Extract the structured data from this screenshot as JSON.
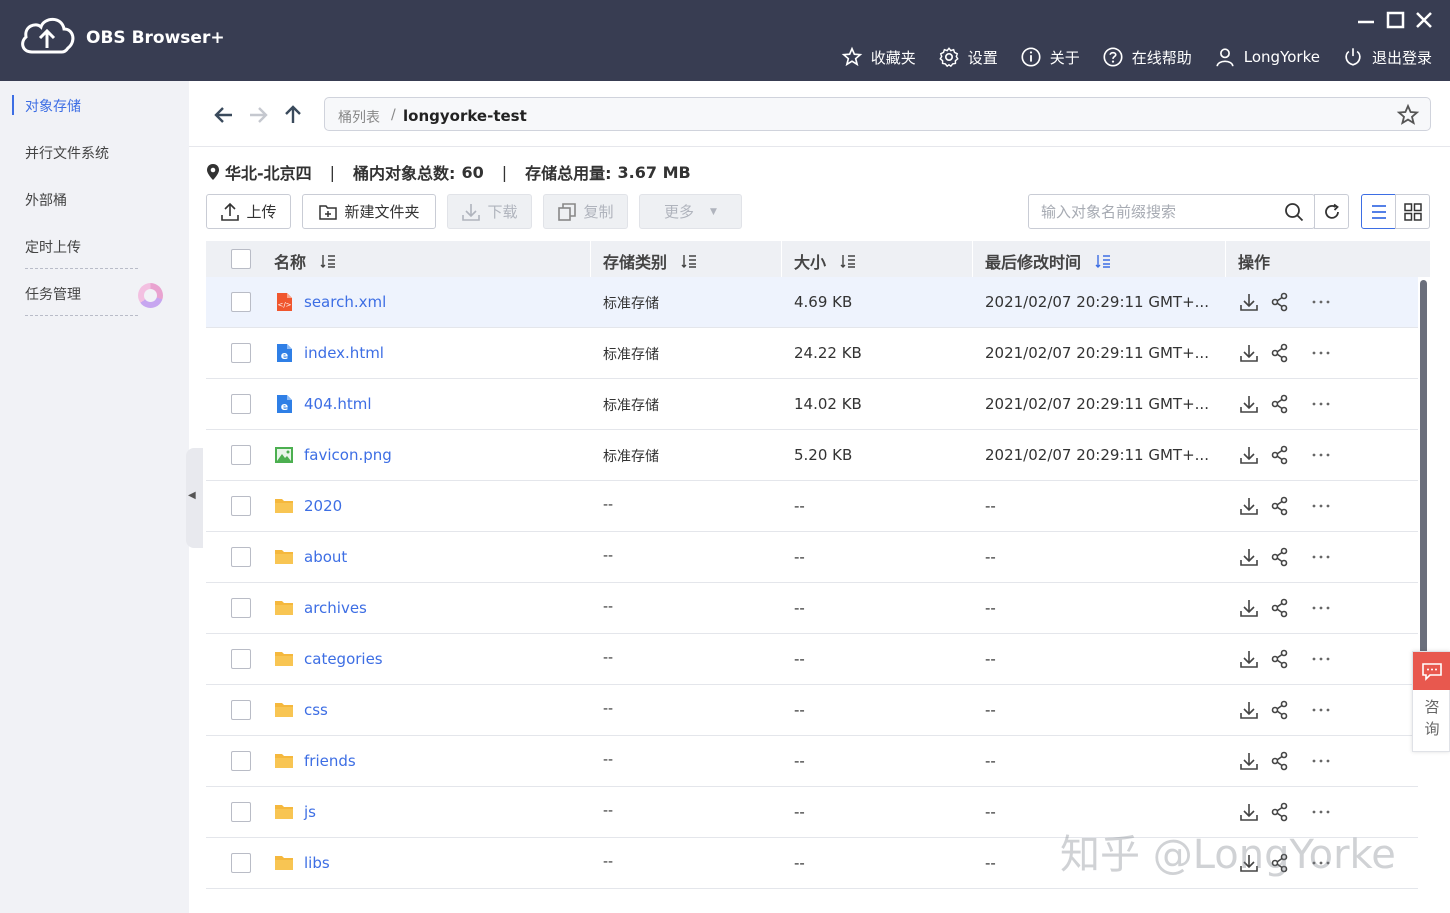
{
  "app": {
    "title": "OBS Browser+",
    "window_controls": [
      "minimize",
      "maximize",
      "close"
    ]
  },
  "top_nav": [
    {
      "label": "收藏夹",
      "icon": "star-icon"
    },
    {
      "label": "设置",
      "icon": "gear-icon"
    },
    {
      "label": "关于",
      "icon": "info-icon"
    },
    {
      "label": "在线帮助",
      "icon": "help-icon"
    },
    {
      "label": "LongYorke",
      "icon": "user-icon"
    },
    {
      "label": "退出登录",
      "icon": "power-icon"
    }
  ],
  "sidebar": {
    "items": [
      {
        "label": "对象存储",
        "active": true
      },
      {
        "label": "并行文件系统",
        "active": false
      },
      {
        "label": "外部桶",
        "active": false
      },
      {
        "label": "定时上传",
        "active": false
      },
      {
        "label": "任务管理",
        "active": false
      }
    ]
  },
  "breadcrumb": {
    "root": "桶列表",
    "separator": "/",
    "current": "longyorke-test"
  },
  "stats": {
    "region": "华北-北京四",
    "count_label": "桶内对象总数:",
    "count_value": "60",
    "usage_label": "存储总用量:",
    "usage_value": "3.67 MB",
    "sep": "|"
  },
  "toolbar": {
    "upload": "上传",
    "new_folder": "新建文件夹",
    "download": "下载",
    "copy": "复制",
    "more": "更多"
  },
  "search": {
    "placeholder": "输入对象名前缀搜索",
    "value": ""
  },
  "table": {
    "columns": [
      "名称",
      "存储类别",
      "大小",
      "最后修改时间",
      "操作"
    ],
    "rows": [
      {
        "name": "search.xml",
        "type": "xml",
        "class": "标准存储",
        "size": "4.69 KB",
        "modified": "2021/02/07 20:29:11 GMT+..."
      },
      {
        "name": "index.html",
        "type": "html",
        "class": "标准存储",
        "size": "24.22 KB",
        "modified": "2021/02/07 20:29:11 GMT+..."
      },
      {
        "name": "404.html",
        "type": "html",
        "class": "标准存储",
        "size": "14.02 KB",
        "modified": "2021/02/07 20:29:11 GMT+..."
      },
      {
        "name": "favicon.png",
        "type": "image",
        "class": "标准存储",
        "size": "5.20 KB",
        "modified": "2021/02/07 20:29:11 GMT+..."
      },
      {
        "name": "2020",
        "type": "folder",
        "class": "--",
        "size": "--",
        "modified": "--"
      },
      {
        "name": "about",
        "type": "folder",
        "class": "--",
        "size": "--",
        "modified": "--"
      },
      {
        "name": "archives",
        "type": "folder",
        "class": "--",
        "size": "--",
        "modified": "--"
      },
      {
        "name": "categories",
        "type": "folder",
        "class": "--",
        "size": "--",
        "modified": "--"
      },
      {
        "name": "css",
        "type": "folder",
        "class": "--",
        "size": "--",
        "modified": "--"
      },
      {
        "name": "friends",
        "type": "folder",
        "class": "--",
        "size": "--",
        "modified": "--"
      },
      {
        "name": "js",
        "type": "folder",
        "class": "--",
        "size": "--",
        "modified": "--"
      },
      {
        "name": "libs",
        "type": "folder",
        "class": "--",
        "size": "--",
        "modified": "--"
      }
    ]
  },
  "consult": {
    "label": "咨询"
  },
  "watermark": "知乎 @LongYorke",
  "colors": {
    "titlebar": "#383d52",
    "accent": "#3d6ee4",
    "folder": "#f5b83d",
    "consult": "#e8584e"
  }
}
